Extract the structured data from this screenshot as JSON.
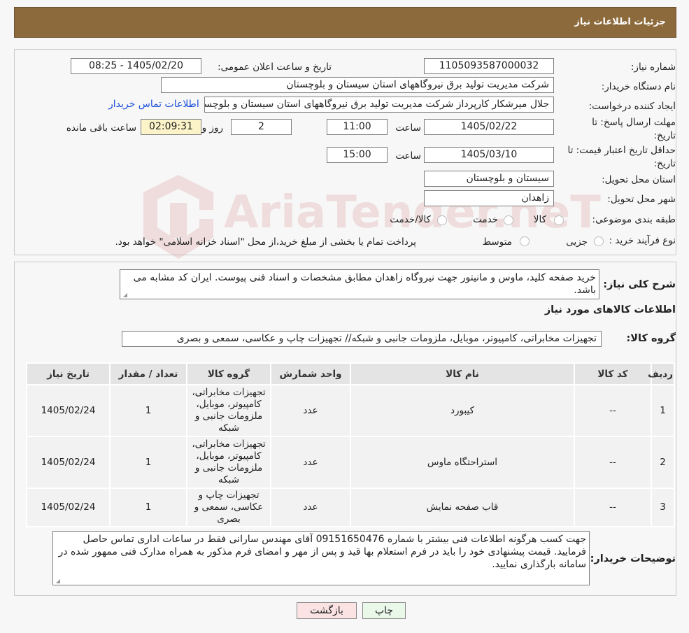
{
  "header": {
    "title": "جزئیات اطلاعات نیاز"
  },
  "form": {
    "need_number_label": "شماره نیاز:",
    "need_number": "1105093587000032",
    "announce_label": "تاریخ و ساعت اعلان عمومی:",
    "announce_value": "1405/02/20 - 08:25",
    "buyer_org_label": "نام دستگاه خریدار:",
    "buyer_org": "شرکت مدیریت تولید برق نیروگاههای استان سیستان و بلوچستان",
    "requester_label": "ایجاد کننده درخواست:",
    "requester": "جلال میرشکار کارپرداز شرکت مدیریت تولید برق نیروگاههای استان سیستان و بلوچستان",
    "contact_link": "اطلاعات تماس خریدار",
    "deadline_label_1": "مهلت ارسال پاسخ: تا",
    "deadline_label_2": "تاریخ:",
    "deadline_date": "1405/02/22",
    "time_label": "ساعت",
    "deadline_time": "11:00",
    "days_value": "2",
    "days_label": "روز و",
    "remaining_time": "02:09:31",
    "remaining_label": "ساعت باقی مانده",
    "validity_label_1": "حداقل تاریخ اعتبار قیمت: تا",
    "validity_label_2": "تاریخ:",
    "validity_date": "1405/03/10",
    "validity_time": "15:00",
    "province_label": "استان محل تحویل:",
    "province": "سیستان و بلوچستان",
    "city_label": "شهر محل تحویل:",
    "city": "زاهدان",
    "category_label": "طبقه بندی موضوعی:",
    "category_options": [
      "کالا",
      "خدمت",
      "کالا/خدمت"
    ],
    "process_label": "نوع فرآیند خرید :",
    "process_options": [
      "جزیی",
      "متوسط"
    ],
    "process_note": "پرداخت تمام یا بخشی از مبلغ خرید،از محل \"اسناد خزانه اسلامی\" خواهد بود."
  },
  "description": {
    "label": "شرح کلی نیاز:",
    "text": "خرید صفحه کلید، ماوس و مانیتور جهت نیروگاه زاهدان مطابق مشخصات و اسناد فنی پیوست. ایران کد مشابه می باشد."
  },
  "goods": {
    "section_title": "اطلاعات کالاهای مورد نیاز",
    "group_label": "گروه کالا:",
    "group_value": "تجهیزات مخابراتی، کامپیوتر، موبایل، ملزومات جانبی و شبکه// تجهیزات چاپ و عکاسی، سمعی و بصری",
    "columns": [
      "ردیف",
      "کد کالا",
      "نام کالا",
      "واحد شمارش",
      "گروه کالا",
      "تعداد / مقدار",
      "تاریخ نیاز"
    ],
    "rows": [
      {
        "index": "1",
        "code": "--",
        "name": "کیبورد",
        "unit": "عدد",
        "group": "تجهیزات مخابراتی، کامپیوتر، موبایل، ملزومات جانبی و شبکه",
        "qty": "1",
        "date": "1405/02/24"
      },
      {
        "index": "2",
        "code": "--",
        "name": "استراحتگاه ماوس",
        "unit": "عدد",
        "group": "تجهیزات مخابراتی، کامپیوتر، موبایل، ملزومات جانبی و شبکه",
        "qty": "1",
        "date": "1405/02/24"
      },
      {
        "index": "3",
        "code": "--",
        "name": "قاب صفحه نمایش",
        "unit": "عدد",
        "group": "تجهیزات چاپ و عکاسی، سمعی و بصری",
        "qty": "1",
        "date": "1405/02/24"
      }
    ]
  },
  "buyer_notes": {
    "label": "توضیحات خریدار:",
    "text": "جهت کسب هرگونه اطلاعات فنی بیشتر با شماره 09151650476 آقای مهندس سارانی فقط در ساعات اداری تماس حاصل فرمایید. قیمت پیشنهادی خود را باید در فرم استعلام بها قید و پس از مهر و امضای فرم مذکور به همراه مدارک فنی ممهور شده در سامانه بارگذاری نمایید."
  },
  "buttons": {
    "print": "چاپ",
    "back": "بازگشت"
  },
  "watermark": {
    "text": "AriaTender.neT"
  },
  "colors": {
    "header_bg": "#8c6a3c",
    "link": "#1a4fd8",
    "back_button_bg": "#fbe3e3",
    "print_button_bg": "#e9f8e9",
    "timer_bg": "#fcf4c8"
  }
}
